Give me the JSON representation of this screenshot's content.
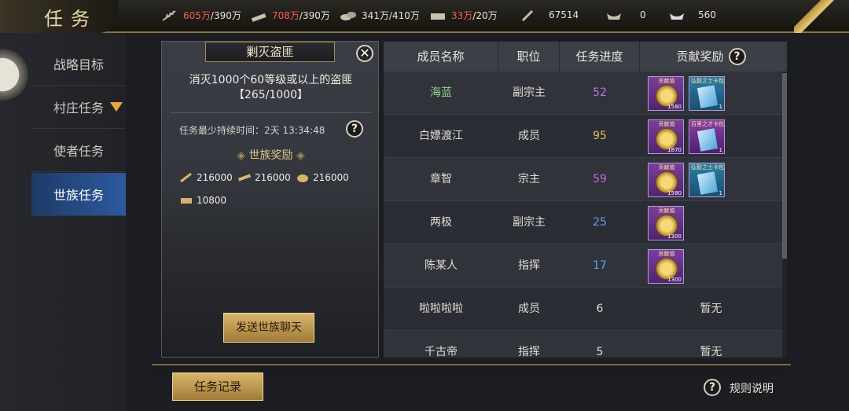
{
  "header": {
    "title": "任务",
    "resources": [
      {
        "icon": "grain-icon",
        "value": "605万",
        "cap": "/390万",
        "warn": true
      },
      {
        "icon": "wood-icon",
        "value": "708万",
        "cap": "/390万",
        "warn": true
      },
      {
        "icon": "stone-icon",
        "value": "341万",
        "cap": "/410万",
        "warn": false
      },
      {
        "icon": "iron-icon",
        "value": "33万",
        "cap": "/20万",
        "warn": true
      },
      {
        "icon": "order-icon",
        "value": "67514",
        "cap": "",
        "warn": false
      },
      {
        "icon": "gold-ingot-icon",
        "value": "0",
        "cap": "",
        "warn": false
      },
      {
        "icon": "silver-ingot-icon",
        "value": "560",
        "cap": "",
        "warn": false
      }
    ]
  },
  "sidebar": {
    "items": [
      {
        "label": "战略目标"
      },
      {
        "label": "村庄任务"
      },
      {
        "label": "使者任务"
      },
      {
        "label": "世族任务"
      }
    ]
  },
  "task": {
    "name": "剿灭盗匪",
    "desc_line1": "消灭1000个60等级或以上的盗匪",
    "desc_line2": "【265/1000】",
    "duration": "任务最少持续时间：2天 13:34:48",
    "reward_title": "世族奖励",
    "rewards": [
      "216000",
      "216000",
      "216000",
      "10800"
    ],
    "send_button": "发送世族聊天"
  },
  "table": {
    "headers": [
      "成员名称",
      "职位",
      "任务进度",
      "贡献奖励"
    ],
    "rows": [
      {
        "name": "海蓝",
        "role": "副宗主",
        "progress": "52",
        "rewards": [
          {
            "type": "coin",
            "label": "贡献值",
            "qty": "1580"
          },
          {
            "type": "card",
            "label": "弘毅之士卡包",
            "qty": "1"
          }
        ]
      },
      {
        "name": "白嫖渡江",
        "role": "成员",
        "progress": "95",
        "rewards": [
          {
            "type": "coin",
            "label": "贡献值",
            "qty": "1870"
          },
          {
            "type": "card2",
            "label": "百里之才卡包",
            "qty": "1"
          }
        ]
      },
      {
        "name": "章智",
        "role": "宗主",
        "progress": "59",
        "rewards": [
          {
            "type": "coin",
            "label": "贡献值",
            "qty": "1580"
          },
          {
            "type": "card",
            "label": "弘毅之士卡包",
            "qty": "1"
          }
        ]
      },
      {
        "name": "两极",
        "role": "副宗主",
        "progress": "25",
        "rewards": [
          {
            "type": "coin",
            "label": "贡献值",
            "qty": "1300"
          }
        ]
      },
      {
        "name": "陈某人",
        "role": "指挥",
        "progress": "17",
        "rewards": [
          {
            "type": "coin",
            "label": "贡献值",
            "qty": "1300"
          }
        ]
      },
      {
        "name": "啦啦啦啦",
        "role": "成员",
        "progress": "6",
        "none": "暂无"
      },
      {
        "name": "千古帝",
        "role": "指挥",
        "progress": "5",
        "none": "暂无"
      }
    ]
  },
  "bottom": {
    "record_button": "任务记录",
    "rules_label": "规则说明"
  },
  "colors": {
    "accent_gold": "#d9b46a",
    "warn_red": "#ff5a4a",
    "active_blue": "#2c5aa0",
    "name_green": "#8fd18f",
    "progress_purple": "#c06ee0",
    "progress_gold": "#e6b85a",
    "progress_blue": "#5aa0e8"
  }
}
